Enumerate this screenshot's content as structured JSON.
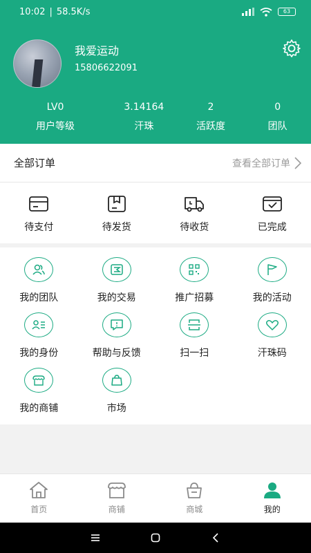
{
  "status": {
    "time": "10:02",
    "speed": "58.5K/s",
    "battery": "63"
  },
  "profile": {
    "username": "我爱运动",
    "phone": "15806622091"
  },
  "stats": [
    {
      "value": "LV0",
      "label": "用户等级"
    },
    {
      "value": "3.14164",
      "label": "汗珠"
    },
    {
      "value": "2",
      "label": "活跃度"
    },
    {
      "value": "0",
      "label": "团队"
    }
  ],
  "orders": {
    "title": "全部订单",
    "view_all": "查看全部订单",
    "items": [
      {
        "label": "待支付",
        "icon": "card-icon"
      },
      {
        "label": "待发货",
        "icon": "box-icon"
      },
      {
        "label": "待收货",
        "icon": "truck-icon"
      },
      {
        "label": "已完成",
        "icon": "check-box-icon"
      }
    ]
  },
  "menu": [
    {
      "label": "我的团队",
      "icon": "team-icon"
    },
    {
      "label": "我的交易",
      "icon": "trade-icon"
    },
    {
      "label": "推广招募",
      "icon": "qrcode-icon"
    },
    {
      "label": "我的活动",
      "icon": "flag-icon"
    },
    {
      "label": "我的身份",
      "icon": "id-icon"
    },
    {
      "label": "帮助与反馈",
      "icon": "feedback-icon"
    },
    {
      "label": "扫一扫",
      "icon": "scan-icon"
    },
    {
      "label": "汗珠码",
      "icon": "heart-icon"
    },
    {
      "label": "我的商铺",
      "icon": "shop-icon"
    },
    {
      "label": "市场",
      "icon": "bag-icon"
    }
  ],
  "tabs": [
    {
      "label": "首页",
      "icon": "home-icon"
    },
    {
      "label": "商铺",
      "icon": "store-icon"
    },
    {
      "label": "商城",
      "icon": "basket-icon"
    },
    {
      "label": "我的",
      "icon": "user-icon",
      "active": true
    }
  ],
  "colors": {
    "brand": "#1aaa82",
    "muted": "#9b9b9b",
    "background": "#f2f2f2"
  }
}
